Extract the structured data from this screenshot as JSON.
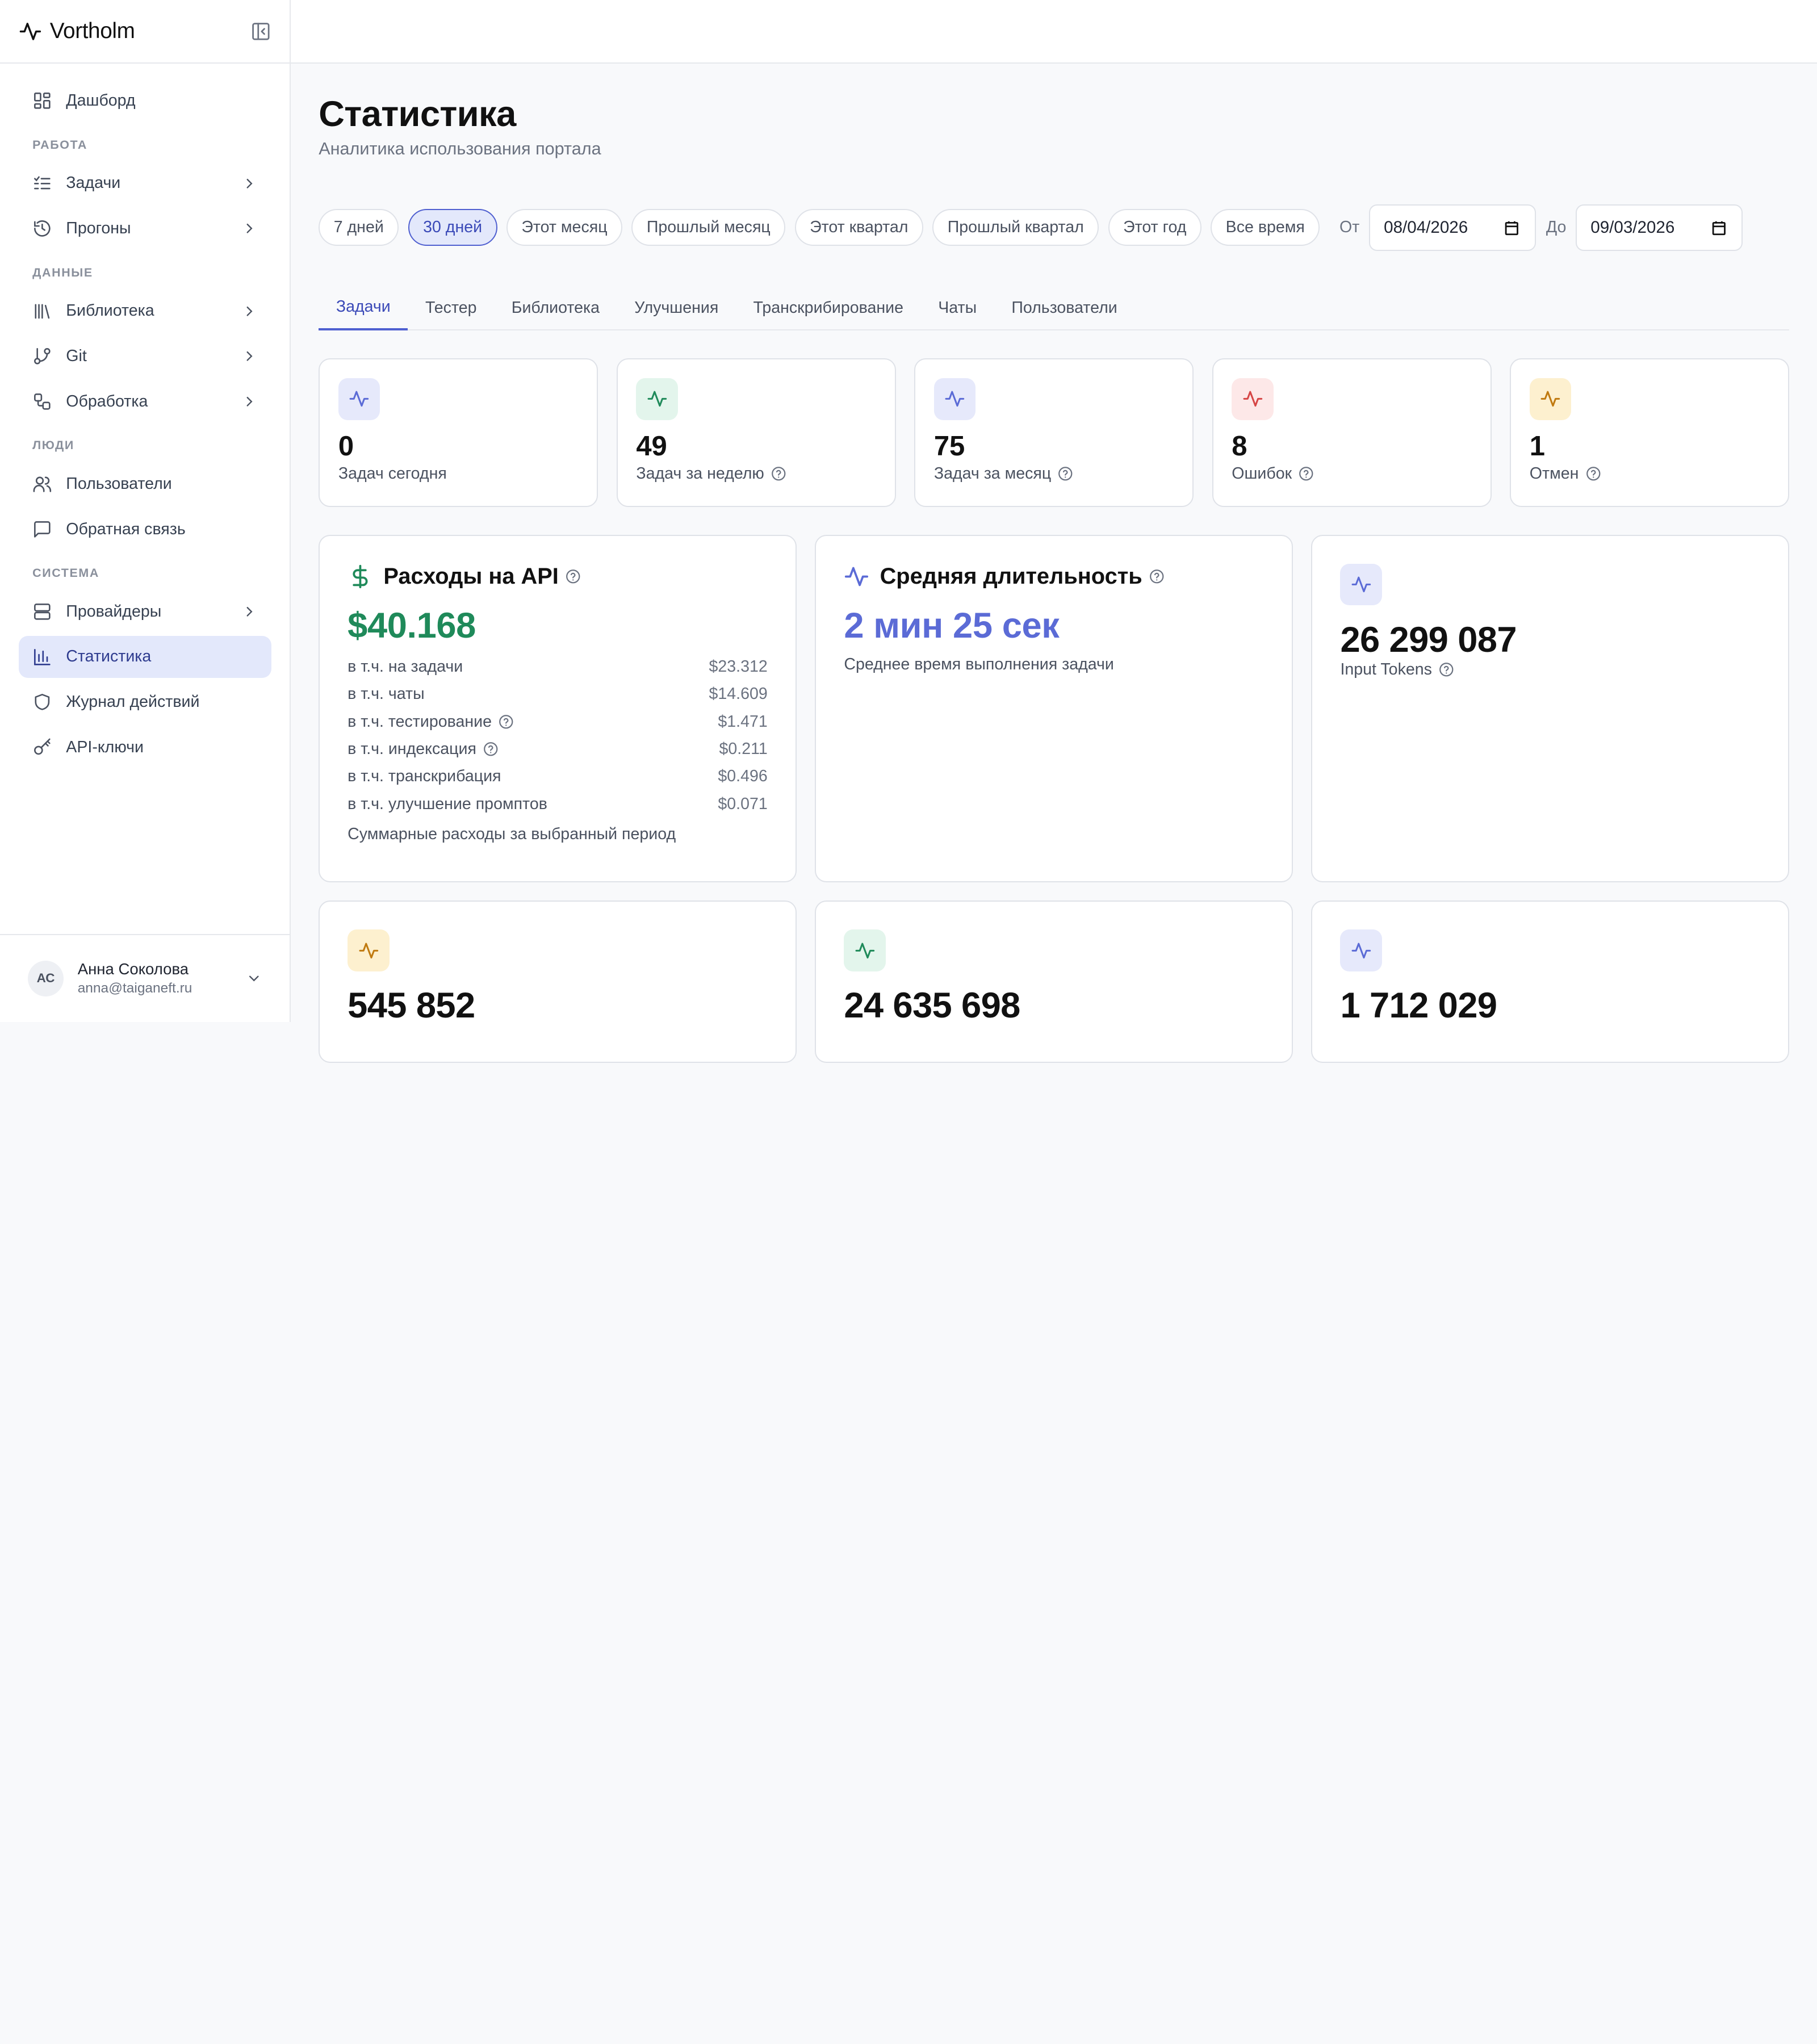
{
  "brand": {
    "name": "Vortholm"
  },
  "sidebar": {
    "top": {
      "label": "Дашборд"
    },
    "sections": {
      "work": "РАБОТА",
      "data": "ДАННЫЕ",
      "people": "ЛЮДИ",
      "system": "СИСТЕМА"
    },
    "items": {
      "tasks": "Задачи",
      "runs": "Прогоны",
      "library": "Библиотека",
      "git": "Git",
      "processing": "Обработка",
      "users": "Пользователи",
      "feedback": "Обратная связь",
      "providers": "Провайдеры",
      "stats": "Статистика",
      "audit": "Журнал действий",
      "apikeys": "API-ключи"
    },
    "user": {
      "initials": "АС",
      "name": "Анна Соколова",
      "email": "anna@taiganeft.ru"
    }
  },
  "page": {
    "title": "Статистика",
    "subtitle": "Аналитика использования портала"
  },
  "filters": {
    "ranges": [
      "7 дней",
      "30 дней",
      "Этот месяц",
      "Прошлый месяц",
      "Этот квартал",
      "Прошлый квартал",
      "Этот год",
      "Все время"
    ],
    "active_range": "30 дней",
    "from_label": "От",
    "from_value": "08/04/2026",
    "to_label": "До",
    "to_value": "09/03/2026"
  },
  "tabs": [
    "Задачи",
    "Тестер",
    "Библиотека",
    "Улучшения",
    "Транскрибирование",
    "Чаты",
    "Пользователи"
  ],
  "active_tab": "Задачи",
  "stats": [
    {
      "value": "0",
      "label": "Задач сегодня",
      "color": "#5b6bd6",
      "bg": "#e6e9fb"
    },
    {
      "value": "49",
      "label": "Задач за неделю",
      "color": "#1f8a5a",
      "bg": "#e3f5ec"
    },
    {
      "value": "75",
      "label": "Задач за месяц",
      "color": "#5b6bd6",
      "bg": "#e6e9fb"
    },
    {
      "value": "8",
      "label": "Ошибок",
      "color": "#d64545",
      "bg": "#fde8e8"
    },
    {
      "value": "1",
      "label": "Отмен",
      "color": "#c07a10",
      "bg": "#fdf0cf"
    }
  ],
  "cost": {
    "title": "Расходы на API",
    "value": "$40.168",
    "rows": [
      {
        "label": "в т.ч. на задачи",
        "value": "$23.312"
      },
      {
        "label": "в т.ч. чаты",
        "value": "$14.609"
      },
      {
        "label": "в т.ч. тестирование",
        "value": "$1.471"
      },
      {
        "label": "в т.ч. индексация",
        "value": "$0.211"
      },
      {
        "label": "в т.ч. транскрибация",
        "value": "$0.496"
      },
      {
        "label": "в т.ч. улучшение промптов",
        "value": "$0.071"
      }
    ],
    "note": "Суммарные расходы за выбранный период",
    "color": "#1f8a5a"
  },
  "duration": {
    "title": "Средняя длительность",
    "value": "2 мин 25 сек",
    "note": "Среднее время выполнения задачи",
    "color": "#5b6bd6"
  },
  "tokens": {
    "input": {
      "value": "26 299 087",
      "label": "Input Tokens"
    }
  },
  "bottom_cards": [
    {
      "value": "545 852",
      "color": "#c07a10",
      "bg": "#fdf0cf"
    },
    {
      "value": "24 635 698",
      "color": "#1f8a5a",
      "bg": "#e3f5ec"
    },
    {
      "value": "1 712 029",
      "color": "#5b6bd6",
      "bg": "#e6e9fb"
    }
  ]
}
